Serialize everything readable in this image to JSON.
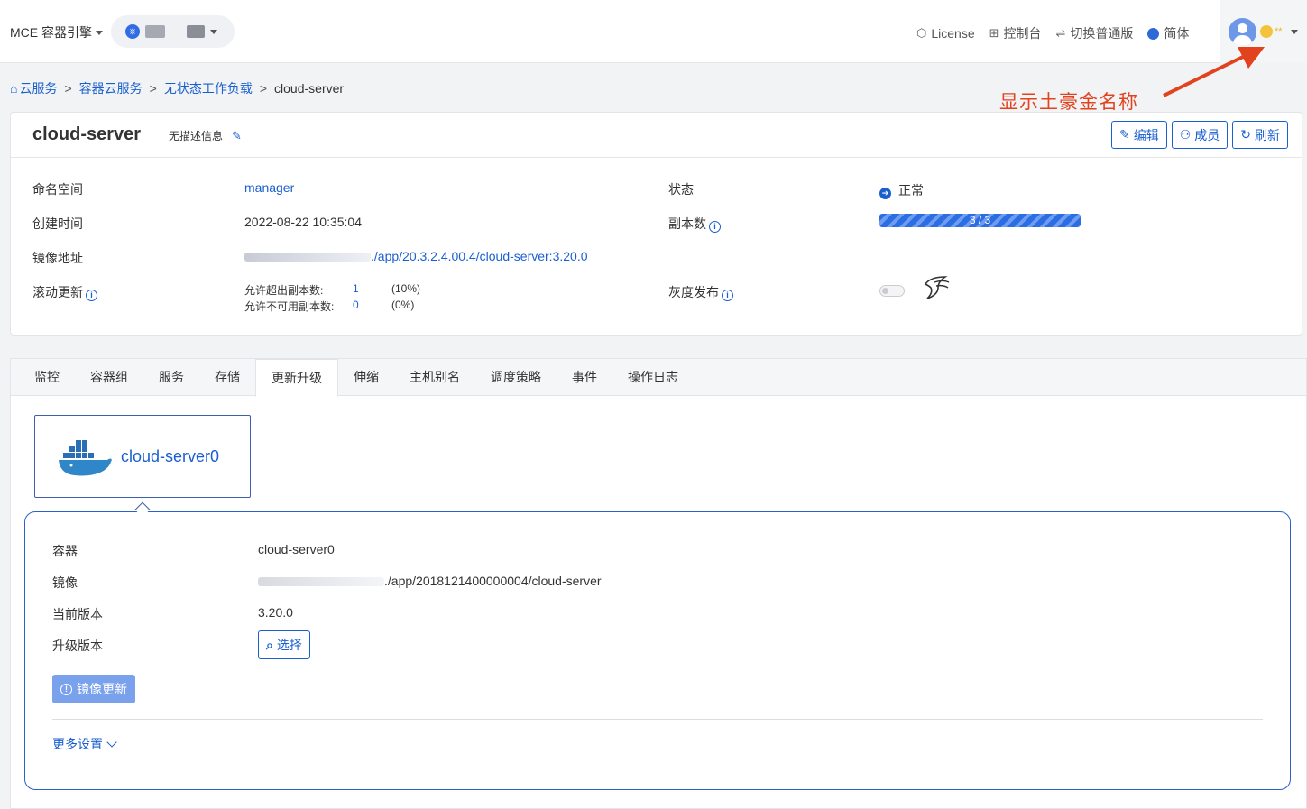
{
  "topbar": {
    "brand": "MCE 容器引擎",
    "links": [
      {
        "icon": "cube-icon",
        "label": "License"
      },
      {
        "icon": "grid-icon",
        "label": "控制台"
      },
      {
        "icon": "switch-icon",
        "label": "切换普通版"
      },
      {
        "icon": "globe-icon",
        "label": "简体"
      }
    ],
    "user_name_masked": "**"
  },
  "annotation": "显示土豪金名称",
  "breadcrumb": [
    "云服务",
    "容器云服务",
    "无状态工作负载",
    "cloud-server"
  ],
  "detail": {
    "title": "cloud-server",
    "description": "无描述信息",
    "buttons": [
      "编辑",
      "成员",
      "刷新"
    ],
    "labels": {
      "namespace": "命名空间",
      "created": "创建时间",
      "image": "镜像地址",
      "rolling": "滚动更新",
      "status": "状态",
      "replicas": "副本数",
      "gray": "灰度发布"
    },
    "namespace": "manager",
    "created": "2022-08-22 10:35:04",
    "image_tail": "./app/20.3.2.4.00.4/cloud-server:3.20.0",
    "status": "正常",
    "replicas_text": "3 / 3",
    "rolling": {
      "surge_label": "允许超出副本数:",
      "surge_value": "1",
      "surge_pct": "(10%)",
      "unavail_label": "允许不可用副本数:",
      "unavail_value": "0",
      "unavail_pct": "(0%)"
    }
  },
  "tabs": [
    "监控",
    "容器组",
    "服务",
    "存储",
    "更新升级",
    "伸缩",
    "主机别名",
    "调度策略",
    "事件",
    "操作日志"
  ],
  "active_tab": "更新升级",
  "container": {
    "tile_label": "cloud-server0",
    "labels": {
      "container": "容器",
      "image": "镜像",
      "current": "当前版本",
      "upgrade": "升级版本"
    },
    "name": "cloud-server0",
    "image_tail": "./app/2018121400000004/cloud-server",
    "current_version": "3.20.0",
    "select_label": "选择",
    "update_label": "镜像更新",
    "more_settings": "更多设置"
  }
}
